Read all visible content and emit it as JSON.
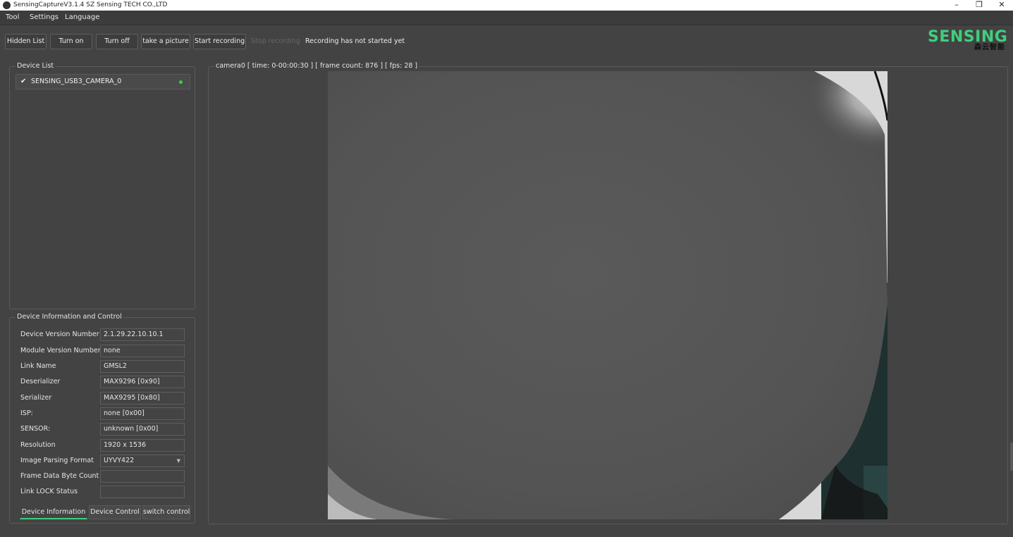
{
  "window": {
    "title": "SensingCaptureV3.1.4 SZ Sensing TECH CO.,LTD",
    "minimize_glyph": "–",
    "restore_glyph": "❐",
    "close_glyph": "✕"
  },
  "menu": [
    "Tool",
    "Settings",
    "Language"
  ],
  "toolbar": {
    "buttons": [
      "Hidden List",
      "Turn on",
      "Turn off",
      "take a picture",
      "Start recording",
      "Stop recording"
    ],
    "status": "Recording has not started yet"
  },
  "logo": {
    "text": "SENSING",
    "subtitle": "森云智能",
    "accent": "#3fcf7d"
  },
  "device_list": {
    "title": "Device List",
    "items": [
      {
        "check": "✔",
        "name": "SENSING_USB3_CAMERA_0",
        "status_color": "#2bd44a"
      }
    ]
  },
  "device_info": {
    "title": "Device Information and Control",
    "rows": [
      {
        "label": "Device Version Number",
        "value": "2.1.29.22.10.10.1"
      },
      {
        "label": "Module Version Number",
        "value": "none"
      },
      {
        "label": "Link Name",
        "value": "GMSL2"
      },
      {
        "label": "Deserializer",
        "value": "MAX9296 [0x90]"
      },
      {
        "label": "Serializer",
        "value": "MAX9295 [0x80]"
      },
      {
        "label": "ISP:",
        "value": "none [0x00]"
      },
      {
        "label": "SENSOR:",
        "value": "unknown [0x00]"
      },
      {
        "label": "Resolution",
        "value": "1920 x 1536"
      },
      {
        "label": "Image Parsing Format",
        "value": "UYVY422"
      },
      {
        "label": "Frame Data Byte Count",
        "value": ""
      },
      {
        "label": "Link LOCK Status",
        "value": ""
      }
    ],
    "tabs": [
      "Device Information",
      "Device Control",
      "switch control"
    ]
  },
  "video": {
    "title": "camera0  [ time: 0-00:00:30 ]  [ frame count: 876 ]  [ fps: 28 ]"
  }
}
